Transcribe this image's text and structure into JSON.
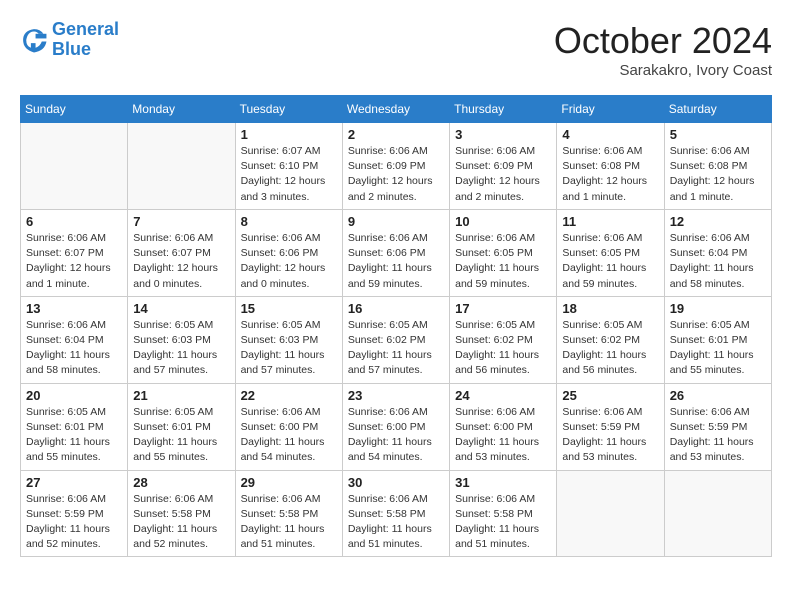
{
  "header": {
    "logo_line1": "General",
    "logo_line2": "Blue",
    "month_title": "October 2024",
    "subtitle": "Sarakakro, Ivory Coast"
  },
  "weekdays": [
    "Sunday",
    "Monday",
    "Tuesday",
    "Wednesday",
    "Thursday",
    "Friday",
    "Saturday"
  ],
  "weeks": [
    [
      {
        "day": "",
        "sunrise": "",
        "sunset": "",
        "daylight": "",
        "empty": true
      },
      {
        "day": "",
        "sunrise": "",
        "sunset": "",
        "daylight": "",
        "empty": true
      },
      {
        "day": "1",
        "sunrise": "Sunrise: 6:07 AM",
        "sunset": "Sunset: 6:10 PM",
        "daylight": "Daylight: 12 hours and 3 minutes.",
        "empty": false
      },
      {
        "day": "2",
        "sunrise": "Sunrise: 6:06 AM",
        "sunset": "Sunset: 6:09 PM",
        "daylight": "Daylight: 12 hours and 2 minutes.",
        "empty": false
      },
      {
        "day": "3",
        "sunrise": "Sunrise: 6:06 AM",
        "sunset": "Sunset: 6:09 PM",
        "daylight": "Daylight: 12 hours and 2 minutes.",
        "empty": false
      },
      {
        "day": "4",
        "sunrise": "Sunrise: 6:06 AM",
        "sunset": "Sunset: 6:08 PM",
        "daylight": "Daylight: 12 hours and 1 minute.",
        "empty": false
      },
      {
        "day": "5",
        "sunrise": "Sunrise: 6:06 AM",
        "sunset": "Sunset: 6:08 PM",
        "daylight": "Daylight: 12 hours and 1 minute.",
        "empty": false
      }
    ],
    [
      {
        "day": "6",
        "sunrise": "Sunrise: 6:06 AM",
        "sunset": "Sunset: 6:07 PM",
        "daylight": "Daylight: 12 hours and 1 minute.",
        "empty": false
      },
      {
        "day": "7",
        "sunrise": "Sunrise: 6:06 AM",
        "sunset": "Sunset: 6:07 PM",
        "daylight": "Daylight: 12 hours and 0 minutes.",
        "empty": false
      },
      {
        "day": "8",
        "sunrise": "Sunrise: 6:06 AM",
        "sunset": "Sunset: 6:06 PM",
        "daylight": "Daylight: 12 hours and 0 minutes.",
        "empty": false
      },
      {
        "day": "9",
        "sunrise": "Sunrise: 6:06 AM",
        "sunset": "Sunset: 6:06 PM",
        "daylight": "Daylight: 11 hours and 59 minutes.",
        "empty": false
      },
      {
        "day": "10",
        "sunrise": "Sunrise: 6:06 AM",
        "sunset": "Sunset: 6:05 PM",
        "daylight": "Daylight: 11 hours and 59 minutes.",
        "empty": false
      },
      {
        "day": "11",
        "sunrise": "Sunrise: 6:06 AM",
        "sunset": "Sunset: 6:05 PM",
        "daylight": "Daylight: 11 hours and 59 minutes.",
        "empty": false
      },
      {
        "day": "12",
        "sunrise": "Sunrise: 6:06 AM",
        "sunset": "Sunset: 6:04 PM",
        "daylight": "Daylight: 11 hours and 58 minutes.",
        "empty": false
      }
    ],
    [
      {
        "day": "13",
        "sunrise": "Sunrise: 6:06 AM",
        "sunset": "Sunset: 6:04 PM",
        "daylight": "Daylight: 11 hours and 58 minutes.",
        "empty": false
      },
      {
        "day": "14",
        "sunrise": "Sunrise: 6:05 AM",
        "sunset": "Sunset: 6:03 PM",
        "daylight": "Daylight: 11 hours and 57 minutes.",
        "empty": false
      },
      {
        "day": "15",
        "sunrise": "Sunrise: 6:05 AM",
        "sunset": "Sunset: 6:03 PM",
        "daylight": "Daylight: 11 hours and 57 minutes.",
        "empty": false
      },
      {
        "day": "16",
        "sunrise": "Sunrise: 6:05 AM",
        "sunset": "Sunset: 6:02 PM",
        "daylight": "Daylight: 11 hours and 57 minutes.",
        "empty": false
      },
      {
        "day": "17",
        "sunrise": "Sunrise: 6:05 AM",
        "sunset": "Sunset: 6:02 PM",
        "daylight": "Daylight: 11 hours and 56 minutes.",
        "empty": false
      },
      {
        "day": "18",
        "sunrise": "Sunrise: 6:05 AM",
        "sunset": "Sunset: 6:02 PM",
        "daylight": "Daylight: 11 hours and 56 minutes.",
        "empty": false
      },
      {
        "day": "19",
        "sunrise": "Sunrise: 6:05 AM",
        "sunset": "Sunset: 6:01 PM",
        "daylight": "Daylight: 11 hours and 55 minutes.",
        "empty": false
      }
    ],
    [
      {
        "day": "20",
        "sunrise": "Sunrise: 6:05 AM",
        "sunset": "Sunset: 6:01 PM",
        "daylight": "Daylight: 11 hours and 55 minutes.",
        "empty": false
      },
      {
        "day": "21",
        "sunrise": "Sunrise: 6:05 AM",
        "sunset": "Sunset: 6:01 PM",
        "daylight": "Daylight: 11 hours and 55 minutes.",
        "empty": false
      },
      {
        "day": "22",
        "sunrise": "Sunrise: 6:06 AM",
        "sunset": "Sunset: 6:00 PM",
        "daylight": "Daylight: 11 hours and 54 minutes.",
        "empty": false
      },
      {
        "day": "23",
        "sunrise": "Sunrise: 6:06 AM",
        "sunset": "Sunset: 6:00 PM",
        "daylight": "Daylight: 11 hours and 54 minutes.",
        "empty": false
      },
      {
        "day": "24",
        "sunrise": "Sunrise: 6:06 AM",
        "sunset": "Sunset: 6:00 PM",
        "daylight": "Daylight: 11 hours and 53 minutes.",
        "empty": false
      },
      {
        "day": "25",
        "sunrise": "Sunrise: 6:06 AM",
        "sunset": "Sunset: 5:59 PM",
        "daylight": "Daylight: 11 hours and 53 minutes.",
        "empty": false
      },
      {
        "day": "26",
        "sunrise": "Sunrise: 6:06 AM",
        "sunset": "Sunset: 5:59 PM",
        "daylight": "Daylight: 11 hours and 53 minutes.",
        "empty": false
      }
    ],
    [
      {
        "day": "27",
        "sunrise": "Sunrise: 6:06 AM",
        "sunset": "Sunset: 5:59 PM",
        "daylight": "Daylight: 11 hours and 52 minutes.",
        "empty": false
      },
      {
        "day": "28",
        "sunrise": "Sunrise: 6:06 AM",
        "sunset": "Sunset: 5:58 PM",
        "daylight": "Daylight: 11 hours and 52 minutes.",
        "empty": false
      },
      {
        "day": "29",
        "sunrise": "Sunrise: 6:06 AM",
        "sunset": "Sunset: 5:58 PM",
        "daylight": "Daylight: 11 hours and 51 minutes.",
        "empty": false
      },
      {
        "day": "30",
        "sunrise": "Sunrise: 6:06 AM",
        "sunset": "Sunset: 5:58 PM",
        "daylight": "Daylight: 11 hours and 51 minutes.",
        "empty": false
      },
      {
        "day": "31",
        "sunrise": "Sunrise: 6:06 AM",
        "sunset": "Sunset: 5:58 PM",
        "daylight": "Daylight: 11 hours and 51 minutes.",
        "empty": false
      },
      {
        "day": "",
        "sunrise": "",
        "sunset": "",
        "daylight": "",
        "empty": true
      },
      {
        "day": "",
        "sunrise": "",
        "sunset": "",
        "daylight": "",
        "empty": true
      }
    ]
  ]
}
